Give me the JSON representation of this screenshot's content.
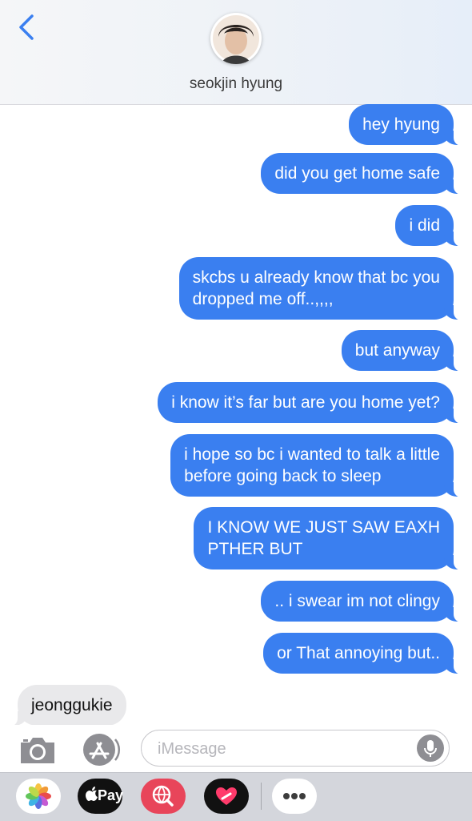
{
  "header": {
    "contact_name": "seokjin hyung",
    "back_icon": "chevron-left-icon",
    "accent_color": "#3a7ff0"
  },
  "messages": [
    {
      "type": "sent",
      "text": "hey hyung"
    },
    {
      "type": "sent",
      "text": "did you get home safe"
    },
    {
      "type": "sent",
      "text": "i did"
    },
    {
      "type": "sent",
      "lines": [
        "skcbs u already know that bc you",
        "dropped me off..,,,,"
      ]
    },
    {
      "type": "sent",
      "text": "but anyway"
    },
    {
      "type": "sent",
      "text": "i know it’s far but are you home yet?"
    },
    {
      "type": "sent",
      "lines": [
        "i hope so bc i wanted to talk a little",
        "before going back to sleep"
      ]
    },
    {
      "type": "sent",
      "lines": [
        "I KNOW WE JUST SAW EAXH",
        "PTHER BUT"
      ]
    },
    {
      "type": "sent",
      "text": ".. i swear im not clingy"
    },
    {
      "type": "sent",
      "text": "or That annoying but.."
    },
    {
      "type": "received",
      "text": "jeonggukie"
    }
  ],
  "composer": {
    "placeholder": "iMessage",
    "camera_icon": "camera-icon",
    "apps_icon": "app-store-icon",
    "mic_icon": "microphone-icon"
  },
  "app_drawer": {
    "photos_icon": "photos-icon",
    "apple_pay_label": "Pay",
    "search_icon": "globe-search-icon",
    "digital_touch_icon": "heart-icon",
    "more_icon": "more-icon"
  }
}
